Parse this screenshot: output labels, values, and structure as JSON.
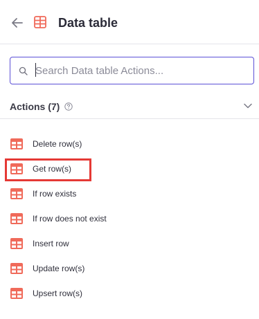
{
  "header": {
    "title": "Data table",
    "back_icon": "arrow-left-icon",
    "app_icon": "table-icon",
    "accent_color": "#f06a5a"
  },
  "search": {
    "placeholder": "Search Data table Actions...",
    "value": "",
    "border_color": "#5b4fd6"
  },
  "actions_section": {
    "title": "Actions (7)",
    "help_icon": "help-circle-icon",
    "toggle_icon": "chevron-down-icon",
    "items": [
      {
        "label": "Delete row(s)",
        "icon": "table-icon"
      },
      {
        "label": "Get row(s)",
        "icon": "table-icon",
        "highlighted": true
      },
      {
        "label": "If row exists",
        "icon": "table-icon"
      },
      {
        "label": "If row does not exist",
        "icon": "table-icon"
      },
      {
        "label": "Insert row",
        "icon": "table-icon"
      },
      {
        "label": "Update row(s)",
        "icon": "table-icon"
      },
      {
        "label": "Upsert row(s)",
        "icon": "table-icon"
      }
    ]
  },
  "highlight_color": "#e53935"
}
